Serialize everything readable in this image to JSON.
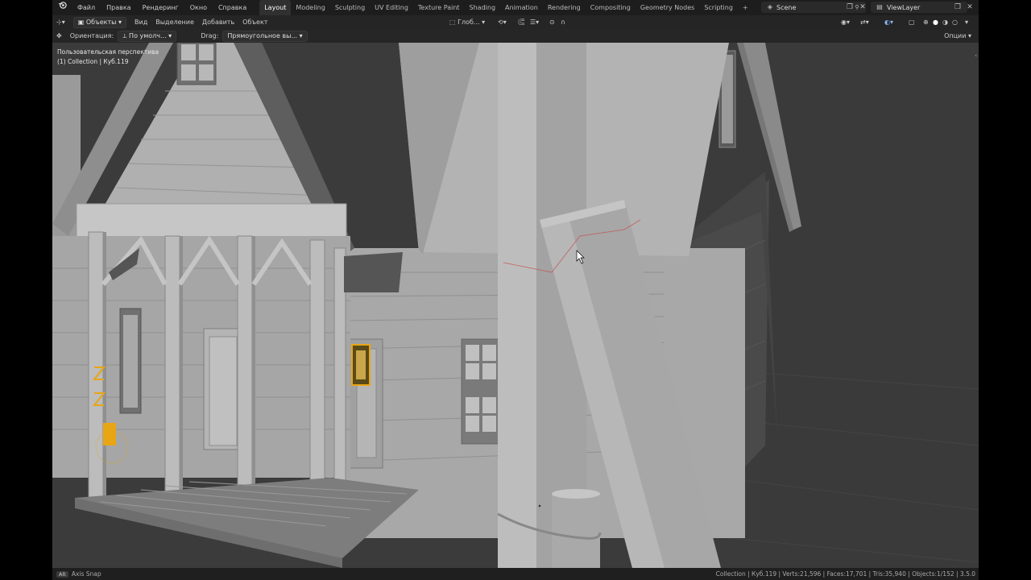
{
  "menu": {
    "items": [
      "Файл",
      "Правка",
      "Рендеринг",
      "Окно",
      "Справка"
    ]
  },
  "workspaces": {
    "tabs": [
      "Layout",
      "Modeling",
      "Sculpting",
      "UV Editing",
      "Texture Paint",
      "Shading",
      "Animation",
      "Rendering",
      "Compositing",
      "Geometry Nodes",
      "Scripting"
    ],
    "active": "Layout",
    "add_label": "+"
  },
  "scene": {
    "name": "Scene"
  },
  "view_layer": {
    "name": "ViewLayer"
  },
  "header": {
    "mode": "Объекты",
    "menus": [
      "Вид",
      "Выделение",
      "Добавить",
      "Объект"
    ],
    "transform_orientation": "Глоб..."
  },
  "tool_header": {
    "orientation_label": "Ориентация:",
    "orientation_value": "По умолч...",
    "drag_label": "Drag:",
    "drag_value": "Прямоугольное вы...",
    "options_label": "Опции"
  },
  "viewport": {
    "view_name": "Пользовательская перспектива",
    "object_info": "(1) Collection | Куб.119"
  },
  "status_bar": {
    "key": "Alt",
    "hint": "Axis Snap",
    "stats": "Collection | Куб.119 | Verts:21,596 | Faces:17,701 | Tris:35,940 | Objects:1/152 | 3.5.0"
  },
  "colors": {
    "accent": "#e8a514",
    "active_tab": "#303030",
    "topbar": "#1d1d1d",
    "viewport_bg": "#3a3a3a"
  },
  "icons": [
    "blender-logo-icon",
    "editor-type-icon",
    "object-mode-icon",
    "transform-gizmo-icon",
    "snap-icon",
    "proportional-edit-icon",
    "visibility-icon",
    "overlay-icon",
    "shading-wire-icon",
    "shading-solid-icon",
    "shading-material-icon",
    "shading-rendered-icon",
    "cursor-icon"
  ]
}
